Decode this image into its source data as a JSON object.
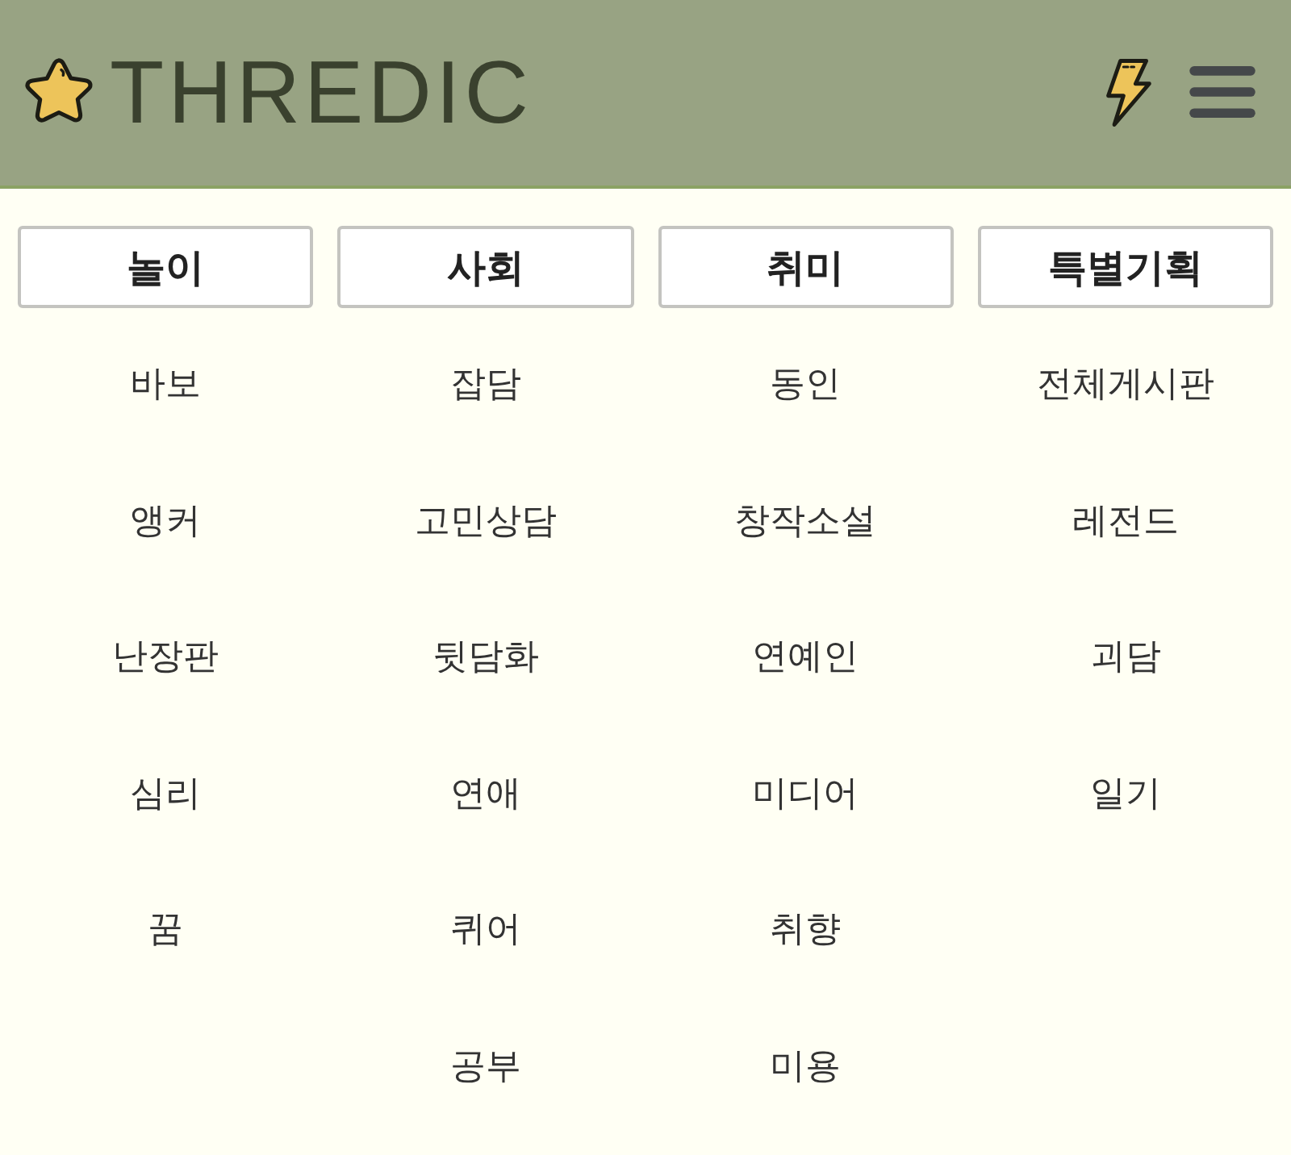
{
  "header": {
    "logo_text": "THREDIC"
  },
  "categories": [
    {
      "title": "놀이",
      "items": [
        "바보",
        "앵커",
        "난장판",
        "심리",
        "꿈"
      ]
    },
    {
      "title": "사회",
      "items": [
        "잡담",
        "고민상담",
        "뒷담화",
        "연애",
        "퀴어",
        "공부"
      ]
    },
    {
      "title": "취미",
      "items": [
        "동인",
        "창작소설",
        "연예인",
        "미디어",
        "취향",
        "미용"
      ]
    },
    {
      "title": "특별기획",
      "items": [
        "전체게시판",
        "레전드",
        "괴담",
        "일기"
      ]
    }
  ]
}
